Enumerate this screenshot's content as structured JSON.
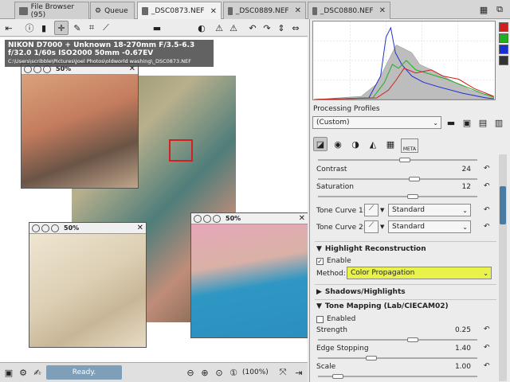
{
  "tabs": [
    {
      "label": "File Browser (95)",
      "icon": "folder-icon"
    },
    {
      "label": "Queue",
      "icon": "gear-icon"
    },
    {
      "label": "_DSC0873.NEF",
      "icon": "image-icon",
      "active": true
    },
    {
      "label": "_DSC0889.NEF",
      "icon": "image-icon"
    },
    {
      "label": "_DSC0880.NEF",
      "icon": "image-icon"
    }
  ],
  "info": {
    "camera": "NIKON D7000 + Unknown 18-270mm F/3.5-6.3",
    "exposure": "f/32.0  1/60s  ISO2000  50mm  -0.67EV",
    "path": "C:\\Users\\scribble\\Pictures\\Joel Photos\\oldworld washing\\_DSC0873.NEF"
  },
  "details": [
    {
      "zoom": "50%"
    },
    {
      "zoom": "50%"
    },
    {
      "zoom": "50%"
    }
  ],
  "status": {
    "ready": "Ready.",
    "zoom": "(100%)"
  },
  "processing": {
    "label": "Processing Profiles",
    "profile": "(Custom)"
  },
  "tools": {
    "contrast_label": "Contrast",
    "contrast_value": "24",
    "saturation_label": "Saturation",
    "saturation_value": "12",
    "curve1_label": "Tone Curve 1:",
    "curve1_value": "Standard",
    "curve2_label": "Tone Curve 2:",
    "curve2_value": "Standard",
    "highlight_title": "Highlight Reconstruction",
    "enable_label": "Enable",
    "method_label": "Method:",
    "method_value": "Color Propagation",
    "shadows_title": "Shadows/Highlights",
    "tonemap_title": "Tone Mapping (Lab/CIECAM02)",
    "enabled_label": "Enabled",
    "strength_label": "Strength",
    "strength_value": "0.25",
    "edge_label": "Edge Stopping",
    "edge_value": "1.40",
    "scale_label": "Scale",
    "scale_value": "1.00",
    "meta_label": "META"
  },
  "colors": {
    "accent": "#4a7ba3",
    "highlight": "#e8f24a",
    "ready": "#7f9eb8"
  }
}
